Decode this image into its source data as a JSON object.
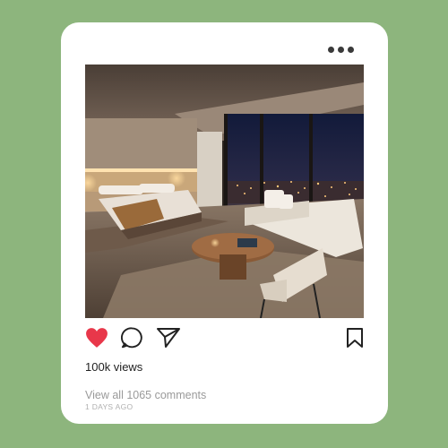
{
  "post": {
    "views_text": "100k views",
    "comments_text": "View all 1065 comments",
    "time_text": "1 DAYS AGO",
    "liked": true
  },
  "icons": {
    "more": "more-horizontal-icon",
    "like": "heart-icon",
    "comment": "comment-bubble-icon",
    "share": "paper-plane-icon",
    "save": "bookmark-icon"
  },
  "colors": {
    "background": "#8db57d",
    "card": "#ffffff",
    "like": "#e8374a"
  }
}
